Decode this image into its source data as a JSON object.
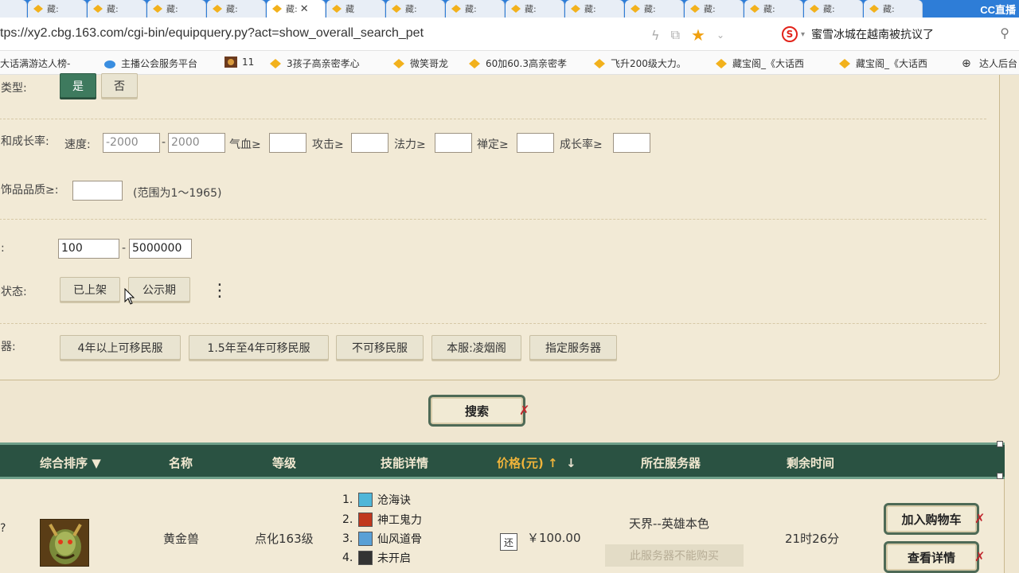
{
  "tabs": [
    {
      "label": "藏:"
    },
    {
      "label": "藏:"
    },
    {
      "label": "藏:"
    },
    {
      "label": "藏:"
    },
    {
      "label": "藏:"
    },
    {
      "label": "藏:"
    },
    {
      "label": "藏"
    },
    {
      "label": "藏:"
    },
    {
      "label": "藏:"
    },
    {
      "label": "藏:"
    },
    {
      "label": "藏:"
    },
    {
      "label": "藏:"
    },
    {
      "label": "藏:"
    },
    {
      "label": "藏:"
    },
    {
      "label": "藏:"
    },
    {
      "label": "藏:"
    }
  ],
  "cc_logo": "CC直播",
  "address": {
    "url": "tps://xy2.cbg.163.com/cgi-bin/equipquery.py?act=show_overall_search_pet",
    "search_engine": "S",
    "search_text": "蜜雪冰城在越南被抗议了"
  },
  "bookmarks": [
    "大话满游达人榜-",
    "主播公会服务平台",
    "11",
    "3孩子高亲密孝心",
    "微笑哥龙",
    "60加60.3高亲密孝",
    "飞升200级大力。",
    "藏宝阁_《大话西",
    "藏宝阁_《大话西",
    "达人后台"
  ],
  "filters": {
    "type_label": "类型:",
    "type_yes": "是",
    "type_no": "否",
    "growth_label": "和成长率:",
    "speed_label": "速度:",
    "speed_min": "-2000",
    "speed_max": "2000",
    "dash": "-",
    "hp_label": "气血≥",
    "atk_label": "攻击≥",
    "magic_label": "法力≥",
    "zen_label": "禅定≥",
    "growth_rate_label": "成长率≥",
    "ornament_label": "饰品品质≥:",
    "ornament_hint": "(范围为1～1965)",
    "price_label": ":",
    "price_min": "100",
    "price_max": "5000000",
    "status_label": "状态:",
    "status_listed": "已上架",
    "status_public": "公示期",
    "server_label": "器:",
    "server_opts": [
      "4年以上可移民服",
      "1.5年至4年可移民服",
      "不可移民服",
      "本服:凌烟阁",
      "指定服务器"
    ]
  },
  "search_button": "搜索",
  "table": {
    "headers": {
      "sort": "综合排序",
      "name": "名称",
      "level": "等级",
      "skills": "技能详情",
      "price": "价格(元)",
      "server": "所在服务器",
      "time_left": "剩余时间"
    },
    "row": {
      "name": "黄金兽",
      "level": "点化163级",
      "skills": [
        {
          "num": "1.",
          "name": "沧海诀",
          "color": "#4fb6d8"
        },
        {
          "num": "2.",
          "name": "神工鬼力",
          "color": "#c0381e"
        },
        {
          "num": "3.",
          "name": "仙风道骨",
          "color": "#5aa0d6"
        },
        {
          "num": "4.",
          "name": "未开启",
          "color": "#333333"
        }
      ],
      "price_tag": "还",
      "price": "￥100.00",
      "server": "天界--英雄本色",
      "no_buy": "此服务器不能购买",
      "time_left": "21时26分",
      "add_cart": "加入购物车",
      "view_detail": "查看详情"
    }
  },
  "left_mark": "?"
}
